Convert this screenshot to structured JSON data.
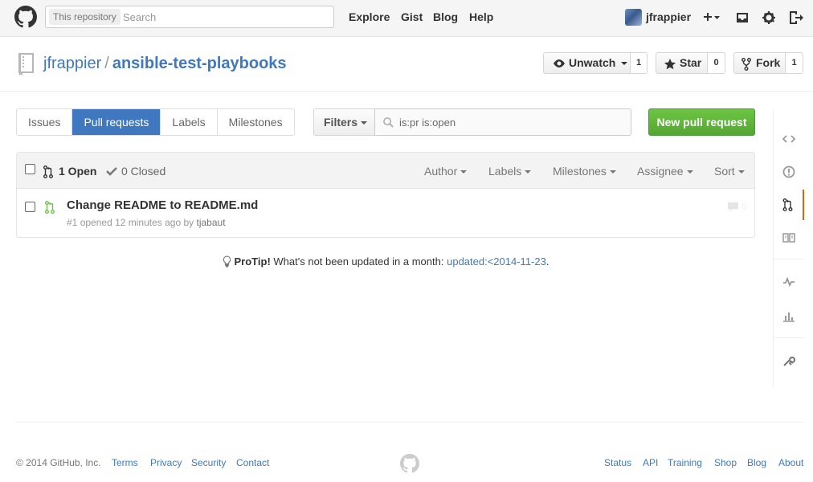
{
  "header": {
    "search_scope": "This repository",
    "search_placeholder": "Search",
    "nav": [
      "Explore",
      "Gist",
      "Blog",
      "Help"
    ],
    "username": "jfrappier",
    "icons": [
      "plus-icon",
      "inbox-icon",
      "gear-icon",
      "sign-out-icon"
    ]
  },
  "repo": {
    "owner": "jfrappier",
    "separator": "/",
    "name": "ansible-test-playbooks",
    "watch_label": "Unwatch",
    "watch_count": "1",
    "star_label": "Star",
    "star_count": "0",
    "fork_label": "Fork",
    "fork_count": "1"
  },
  "subnav": {
    "tabs": [
      "Issues",
      "Pull requests",
      "Labels",
      "Milestones"
    ],
    "selected": "Pull requests",
    "filters_label": "Filters",
    "query": "is:pr is:open",
    "new_pr_label": "New pull request"
  },
  "list": {
    "open_label": "1 Open",
    "closed_label": "0 Closed",
    "filters": [
      "Author",
      "Labels",
      "Milestones",
      "Assignee",
      "Sort"
    ],
    "items": [
      {
        "title": "Change README to README.md",
        "number": "#1",
        "opened_text": "opened 12 minutes ago by",
        "author": "tjabaut",
        "comments": "0"
      }
    ]
  },
  "protip": {
    "label": "ProTip!",
    "text": "What's not been updated in a month:",
    "link": "updated:<2014-11-23",
    "suffix": "."
  },
  "sidebar": {
    "items": [
      "code-icon",
      "issue-icon",
      "pull-request-icon",
      "wiki-icon",
      "pulse-icon",
      "graph-icon",
      "settings-icon"
    ],
    "selected": "pull-request-icon"
  },
  "footer": {
    "copyright": "© 2014 GitHub, Inc.",
    "left_links": [
      "Terms",
      "Privacy",
      "Security",
      "Contact"
    ],
    "right_links": [
      "Status",
      "API",
      "Training",
      "Shop",
      "Blog",
      "About"
    ]
  },
  "colors": {
    "link": "#4078c0",
    "selected_tab": "#4078c0",
    "new_pr_button": "#6cc644",
    "open_pr_icon": "#6cc644",
    "sidebar_selected": "#d26911"
  }
}
